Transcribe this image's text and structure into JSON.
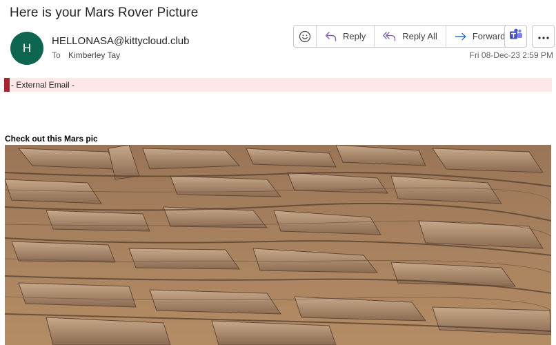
{
  "email": {
    "subject": "Here is your Mars Rover Picture",
    "avatar_initial": "H",
    "sender": "HELLONASA@kittycloud.club",
    "to_label": "To",
    "recipient": "Kimberley Tay",
    "date": "Fri 08-Dec-23 2:59 PM",
    "external_banner": "- External Email -",
    "body_heading": "Check out this Mars pic"
  },
  "toolbar": {
    "reply_label": "Reply",
    "reply_all_label": "Reply All",
    "forward_label": "Forward"
  },
  "icons": [
    "emoji-icon",
    "reply-icon",
    "reply-all-icon",
    "forward-icon",
    "teams-icon",
    "more-icon"
  ],
  "colors": {
    "avatar": "#0f6650",
    "banner_bg": "#fde7e9",
    "banner_bar": "#a4262c",
    "accent": "#5b5fc7"
  }
}
